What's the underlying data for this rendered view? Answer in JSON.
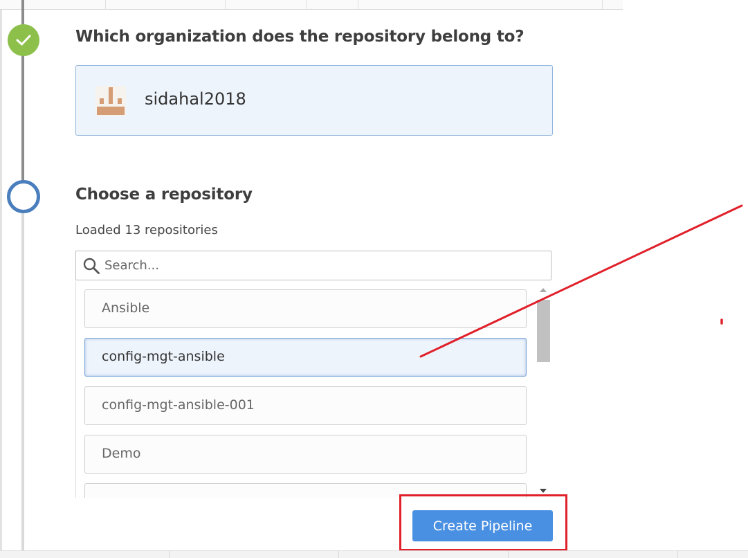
{
  "steps": {
    "organization": {
      "question": "Which organization does the repository belong to?",
      "selected_org": "sidahal2018",
      "status": "complete"
    },
    "repository": {
      "question": "Choose a repository",
      "loaded_text": "Loaded 13 repositories",
      "status": "current"
    }
  },
  "search": {
    "placeholder": "Search...",
    "value": ""
  },
  "repositories": [
    {
      "name": "Ansible",
      "selected": false
    },
    {
      "name": "config-mgt-ansible",
      "selected": true
    },
    {
      "name": "config-mgt-ansible-001",
      "selected": false
    },
    {
      "name": "Demo",
      "selected": false
    }
  ],
  "actions": {
    "create_label": "Create Pipeline"
  },
  "colors": {
    "accent": "#4a90e2",
    "step_done": "#8cc04b",
    "step_current": "#4a7ebd",
    "annotation": "#e0202a",
    "selected_bg": "#eef4fc"
  },
  "icons": {
    "step_done": "checkmark-icon",
    "search": "magnifier-icon",
    "org_avatar": "identicon"
  }
}
